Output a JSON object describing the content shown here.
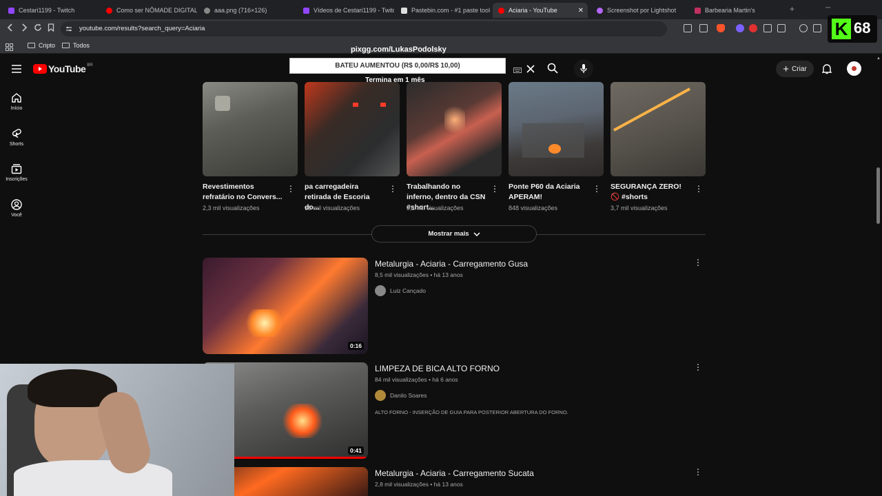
{
  "browser": {
    "tabs": [
      {
        "title": "Cestari1199 - Twitch",
        "color": "#9146ff"
      },
      {
        "title": "Como ser NÔMADE DIGITAL e",
        "color": "#ff0000"
      },
      {
        "title": "aaa.png (716×126)",
        "color": "#888888"
      },
      {
        "title": "Vídeos de Cestari1199 - Twitch",
        "color": "#9146ff"
      },
      {
        "title": "Pastebin.com - #1 paste tool s",
        "color": "#dddddd"
      },
      {
        "title": "Aciaria - YouTube",
        "color": "#ff0000"
      },
      {
        "title": "Screenshot por Lightshot",
        "color": "#b565f7"
      },
      {
        "title": "Barbearia Martin's",
        "color": "#c03060"
      }
    ],
    "active_tab_close": "✕",
    "url": "youtube.com/results?search_query=Aciaria",
    "bookmarks": [
      "Cripto",
      "Todos"
    ]
  },
  "kick_badge": {
    "letter": "K",
    "count": "68"
  },
  "overlay": {
    "user": "pixgg.com/LukasPodolsky",
    "alert": "BATEU AUMENTOU (R$ 0,00/R$ 10,00)",
    "alert_sub": "Termina em 1 mês"
  },
  "youtube": {
    "logo": "YouTube",
    "logo_country": "BR",
    "create_label": "Criar",
    "sidebar": [
      {
        "label": "Início",
        "icon": "home-icon"
      },
      {
        "label": "Shorts",
        "icon": "shorts-icon"
      },
      {
        "label": "Inscrições",
        "icon": "subscriptions-icon"
      },
      {
        "label": "Você",
        "icon": "you-icon"
      }
    ],
    "shorts": [
      {
        "title": "Revestimentos refratário no Convers...",
        "views": "2,3 mil visualizações"
      },
      {
        "title": "pa carregadeira retirada de Escoria do...",
        "views": "18 mil visualizações"
      },
      {
        "title": "Trabalhando no inferno, dentro da CSN #short...",
        "views": "9,1 mil visualizações"
      },
      {
        "title": "Ponte P60 da Aciaria APERAM!",
        "views": "848 visualizações"
      },
      {
        "title": "SEGURANÇA ZERO! 🚫 #shorts",
        "views": "3,7 mil visualizações"
      }
    ],
    "show_more": "Mostrar mais",
    "videos": [
      {
        "title": "Metalurgia - Aciaria - Carregamento Gusa",
        "views": "8,5 mil visualizações",
        "age": "há 13 anos",
        "channel": "Luiz Cançado",
        "duration": "0:16",
        "description": ""
      },
      {
        "title": "LIMPEZA DE BICA ALTO FORNO",
        "views": "84 mil visualizações",
        "age": "há 6 anos",
        "channel": "Danilo Soares",
        "duration": "0:41",
        "description": "ALTO FORNO - INSERÇÃO DE GUIA PARA POSTERIOR ABERTURA DO FORNO."
      },
      {
        "title": "Metalurgia - Aciaria - Carregamento Sucata",
        "views": "2,8 mil visualizações",
        "age": "há 13 anos",
        "channel": "",
        "duration": "",
        "description": ""
      }
    ]
  }
}
